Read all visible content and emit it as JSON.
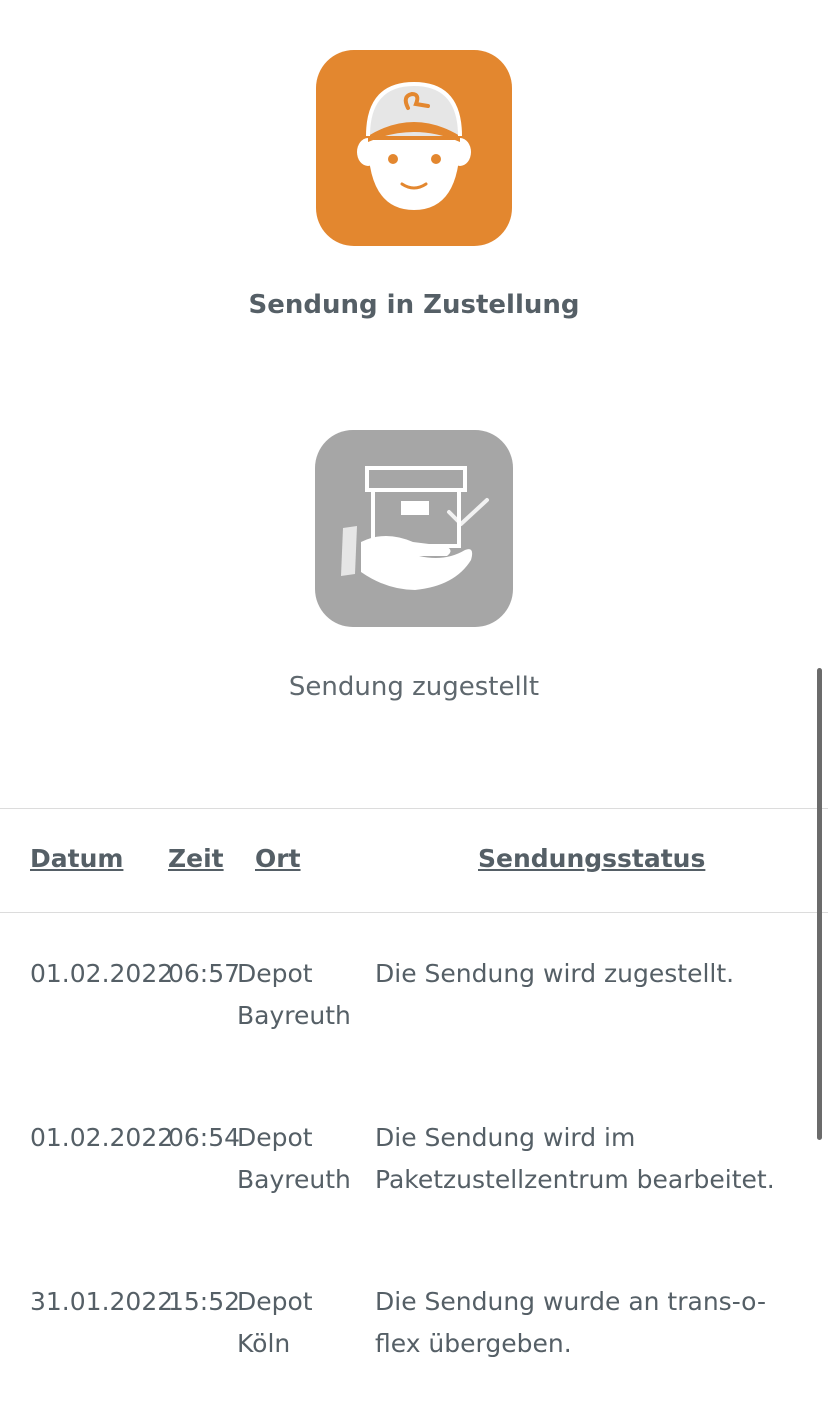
{
  "status_steps": [
    {
      "label": "Sendung in Zustellung",
      "icon": "delivery-man-icon",
      "active": true
    },
    {
      "label": "Sendung zugestellt",
      "icon": "package-delivered-hand-icon",
      "active": false
    }
  ],
  "table": {
    "headers": {
      "date": "Datum",
      "time": "Zeit",
      "location": "Ort",
      "status": "Sendungsstatus"
    },
    "rows": [
      {
        "date": "01.02.2022",
        "time": "06:57",
        "location_line1": "Depot",
        "location_line2": "Bayreuth",
        "status_line1": "Die Sendung wird zugestellt.",
        "status_line2": ""
      },
      {
        "date": "01.02.2022",
        "time": "06:54",
        "location_line1": "Depot",
        "location_line2": "Bayreuth",
        "status_line1": "Die Sendung wird im",
        "status_line2": "Paketzustellzentrum bearbeitet."
      },
      {
        "date": "31.01.2022",
        "time": "15:52",
        "location_line1": "Depot",
        "location_line2": "Köln",
        "status_line1": "Die Sendung wurde an trans-o-",
        "status_line2": "flex übergeben."
      }
    ]
  },
  "colors": {
    "active": "#e3872f",
    "inactive": "#a6a6a6",
    "text": "#555f66"
  }
}
